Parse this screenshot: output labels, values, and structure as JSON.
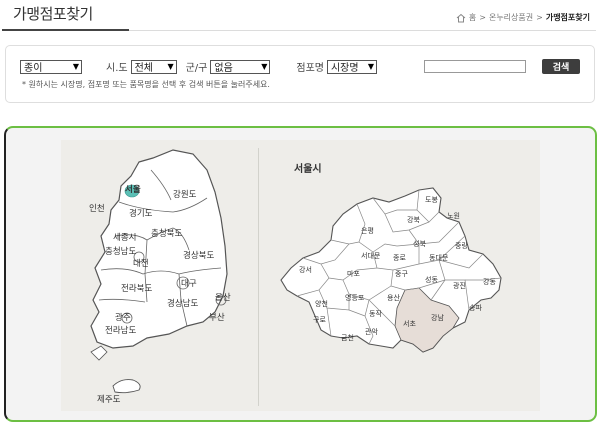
{
  "header": {
    "title": "가맹점포찾기",
    "breadcrumb": {
      "home_icon": "home-icon",
      "home": "홈",
      "sep": ">",
      "section": "온누리상품권",
      "current": "가맹점포찾기"
    }
  },
  "search": {
    "type_select": "종이",
    "sido_label": "시.도",
    "sido_select": "전체",
    "gugun_label": "군/구",
    "gugun_select": "없음",
    "store_label": "점포명",
    "store_select": "시장명",
    "input_value": "",
    "button_label": "검색",
    "hint": "* 원하시는 시장명, 점포명 또는 품목명을 선택 후 검색 버튼을 눌러주세요."
  },
  "korea_map": {
    "regions": [
      "서울",
      "인천",
      "강원도",
      "경기도",
      "세종시",
      "충청북도",
      "충청남도",
      "대전",
      "경상북도",
      "대구",
      "전라북도",
      "울산",
      "경상남도",
      "부산",
      "광주",
      "전라남도",
      "제주도"
    ],
    "highlighted": "서울",
    "highlight_color": "#5bbfb5"
  },
  "seoul_map": {
    "title": "서울시",
    "districts": [
      "도봉",
      "강북",
      "노원",
      "은평",
      "성북",
      "중랑",
      "서대문",
      "종로",
      "동대문",
      "강서",
      "마포",
      "중구",
      "성동",
      "광진",
      "강동",
      "양천",
      "영등포",
      "용산",
      "송파",
      "구로",
      "동작",
      "서초",
      "강남",
      "금천",
      "관악"
    ],
    "highlighted": "서초",
    "highlight_color": "#e6ddd7"
  },
  "colors": {
    "frame_green": "#6cbf43",
    "frame_dark": "#222222",
    "button_bg": "#3d3d3d"
  }
}
